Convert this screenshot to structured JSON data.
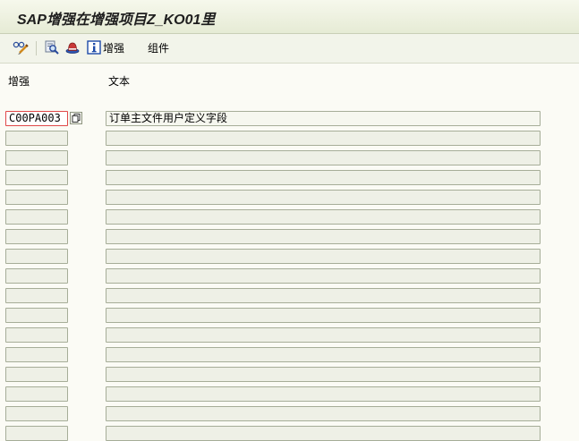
{
  "window": {
    "title": "SAP增强在增强项目Z_KO01里"
  },
  "toolbar": {
    "display_change_icon": "glasses-pencil-icon",
    "icon2": "magnifier-icon",
    "icon3": "hat-icon",
    "info_label": "增强",
    "component_label": "组件"
  },
  "table": {
    "col_enhancement": "增强",
    "col_text": "文本",
    "rows": [
      {
        "enhancement": "C00PA003",
        "text": "订单主文件用户定义字段"
      },
      {
        "enhancement": "",
        "text": ""
      },
      {
        "enhancement": "",
        "text": ""
      },
      {
        "enhancement": "",
        "text": ""
      },
      {
        "enhancement": "",
        "text": ""
      },
      {
        "enhancement": "",
        "text": ""
      },
      {
        "enhancement": "",
        "text": ""
      },
      {
        "enhancement": "",
        "text": ""
      },
      {
        "enhancement": "",
        "text": ""
      },
      {
        "enhancement": "",
        "text": ""
      },
      {
        "enhancement": "",
        "text": ""
      },
      {
        "enhancement": "",
        "text": ""
      },
      {
        "enhancement": "",
        "text": ""
      },
      {
        "enhancement": "",
        "text": ""
      },
      {
        "enhancement": "",
        "text": ""
      },
      {
        "enhancement": "",
        "text": ""
      },
      {
        "enhancement": "",
        "text": ""
      }
    ]
  },
  "colors": {
    "titlebar": "#e6ebd5",
    "field_bg": "#eef0e6",
    "field_border": "#a6ad98",
    "focus_border": "#e04848"
  }
}
